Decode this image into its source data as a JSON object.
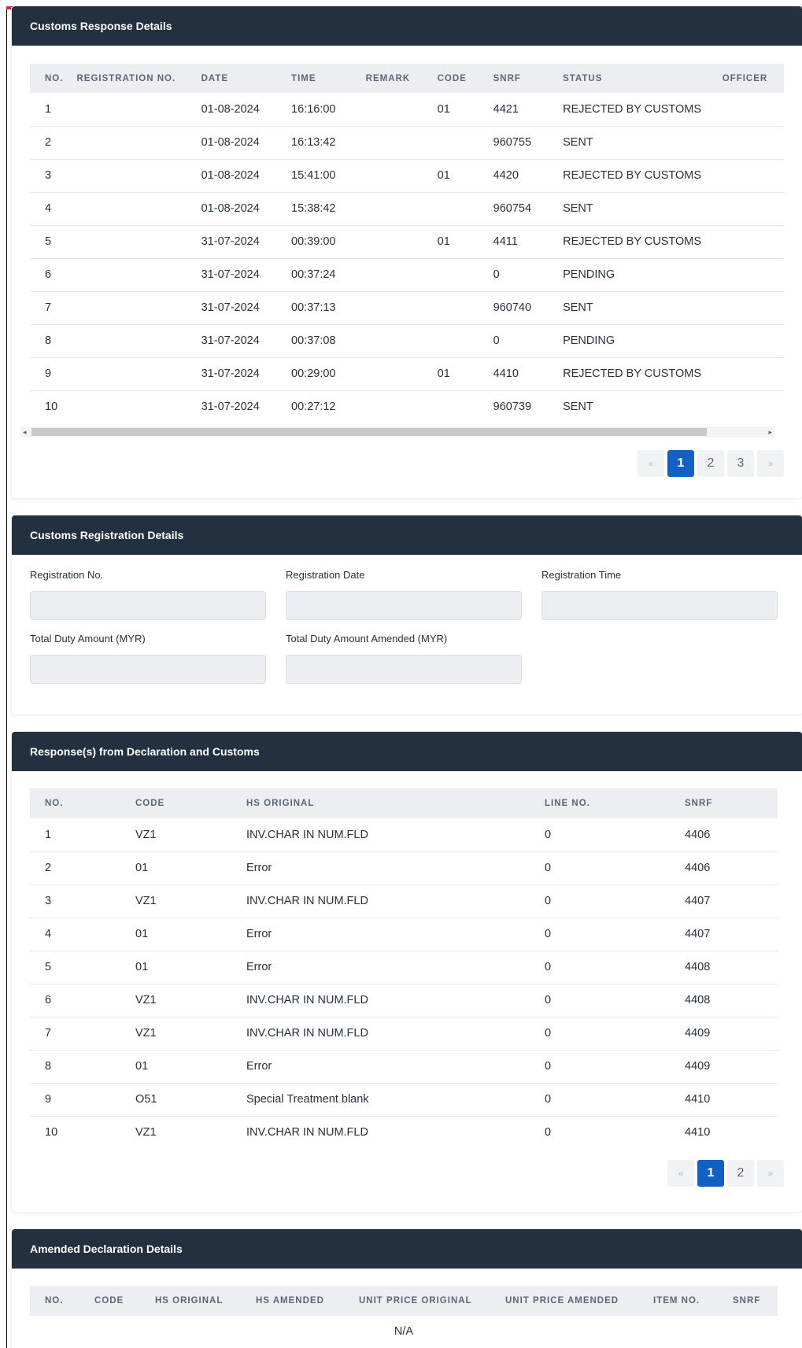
{
  "response_details": {
    "title": "Customs Response Details",
    "columns": [
      "NO.",
      "REGISTRATION NO.",
      "DATE",
      "TIME",
      "REMARK",
      "CODE",
      "SNRF",
      "STATUS",
      "OFFICER"
    ],
    "rows": [
      [
        "1",
        "",
        "01-08-2024",
        "16:16:00",
        "",
        "01",
        "4421",
        "REJECTED BY CUSTOMS"
      ],
      [
        "2",
        "",
        "01-08-2024",
        "16:13:42",
        "",
        "",
        "960755",
        "SENT"
      ],
      [
        "3",
        "",
        "01-08-2024",
        "15:41:00",
        "",
        "01",
        "4420",
        "REJECTED BY CUSTOMS"
      ],
      [
        "4",
        "",
        "01-08-2024",
        "15:38:42",
        "",
        "",
        "960754",
        "SENT"
      ],
      [
        "5",
        "",
        "31-07-2024",
        "00:39:00",
        "",
        "01",
        "4411",
        "REJECTED BY CUSTOMS"
      ],
      [
        "6",
        "",
        "31-07-2024",
        "00:37:24",
        "",
        "",
        "0",
        "PENDING"
      ],
      [
        "7",
        "",
        "31-07-2024",
        "00:37:13",
        "",
        "",
        "960740",
        "SENT"
      ],
      [
        "8",
        "",
        "31-07-2024",
        "00:37:08",
        "",
        "",
        "0",
        "PENDING"
      ],
      [
        "9",
        "",
        "31-07-2024",
        "00:29:00",
        "",
        "01",
        "4410",
        "REJECTED BY CUSTOMS"
      ],
      [
        "10",
        "",
        "31-07-2024",
        "00:27:12",
        "",
        "",
        "960739",
        "SENT"
      ]
    ],
    "pagination": {
      "prev": "«",
      "pages": [
        "1",
        "2",
        "3"
      ],
      "next": "»",
      "active": "1"
    }
  },
  "registration_details": {
    "title": "Customs Registration Details",
    "fields": {
      "registration_no": {
        "label": "Registration No.",
        "value": ""
      },
      "registration_date": {
        "label": "Registration Date",
        "value": ""
      },
      "registration_time": {
        "label": "Registration Time",
        "value": ""
      },
      "total_duty": {
        "label": "Total Duty Amount (MYR)",
        "value": ""
      },
      "total_duty_amended": {
        "label": "Total Duty Amount Amended (MYR)",
        "value": ""
      }
    }
  },
  "declaration_responses": {
    "title": "Response(s) from Declaration and Customs",
    "columns": [
      "NO.",
      "CODE",
      "HS ORIGINAL",
      "LINE NO.",
      "SNRF"
    ],
    "rows": [
      [
        "1",
        "VZ1",
        "INV.CHAR IN NUM.FLD",
        "0",
        "4406"
      ],
      [
        "2",
        "01",
        "Error",
        "0",
        "4406"
      ],
      [
        "3",
        "VZ1",
        "INV.CHAR IN NUM.FLD",
        "0",
        "4407"
      ],
      [
        "4",
        "01",
        "Error",
        "0",
        "4407"
      ],
      [
        "5",
        "01",
        "Error",
        "0",
        "4408"
      ],
      [
        "6",
        "VZ1",
        "INV.CHAR IN NUM.FLD",
        "0",
        "4408"
      ],
      [
        "7",
        "VZ1",
        "INV.CHAR IN NUM.FLD",
        "0",
        "4409"
      ],
      [
        "8",
        "01",
        "Error",
        "0",
        "4409"
      ],
      [
        "9",
        "O51",
        "Special Treatment blank",
        "0",
        "4410"
      ],
      [
        "10",
        "VZ1",
        "INV.CHAR IN NUM.FLD",
        "0",
        "4410"
      ]
    ],
    "pagination": {
      "prev": "«",
      "pages": [
        "1",
        "2"
      ],
      "next": "»",
      "active": "1"
    }
  },
  "amended_details": {
    "title": "Amended Declaration Details",
    "columns": [
      "NO.",
      "CODE",
      "HS ORIGINAL",
      "HS AMENDED",
      "UNIT PRICE ORIGINAL",
      "UNIT PRICE AMENDED",
      "ITEM NO.",
      "SNRF"
    ],
    "empty_text": "N/A"
  }
}
